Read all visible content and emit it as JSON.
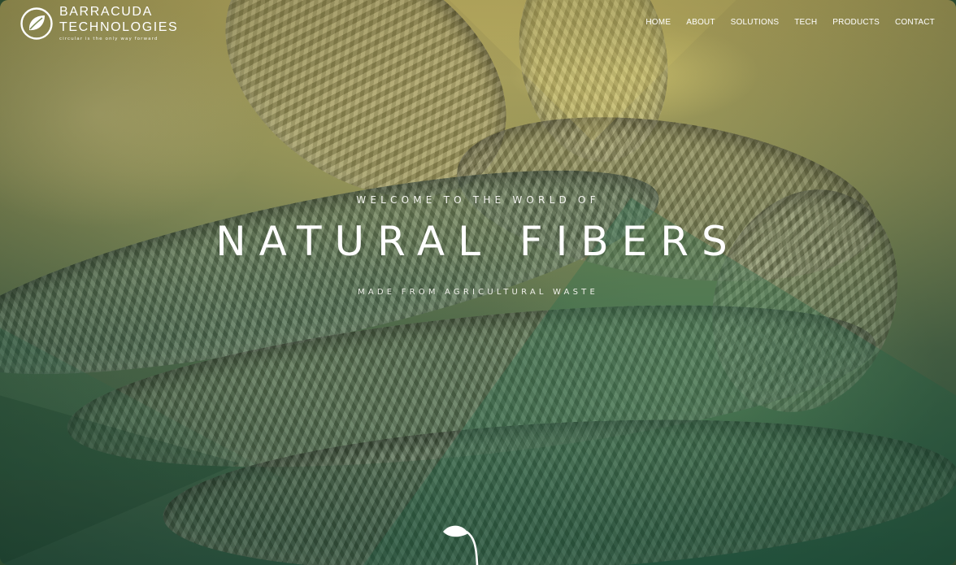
{
  "brand": {
    "name_line1": "BARRACUDA",
    "name_line2": "TECHNOLOGIES",
    "tagline": "circular is the only way forward"
  },
  "nav": {
    "items": [
      "HOME",
      "ABOUT",
      "SOLUTIONS",
      "TECH",
      "PRODUCTS",
      "CONTACT"
    ]
  },
  "hero": {
    "eyebrow": "WELCOME TO THE WORLD OF",
    "title": "NATURAL FIBERS",
    "subtitle": "MADE FROM AGRICULTURAL WASTE"
  },
  "icons": {
    "logo": "leaf-circle-logo-icon",
    "scroll": "sprout-icon"
  },
  "colors": {
    "text": "#ffffff",
    "overlay_green": "#2f6a4f",
    "overlay_gold": "#c9b45c"
  }
}
